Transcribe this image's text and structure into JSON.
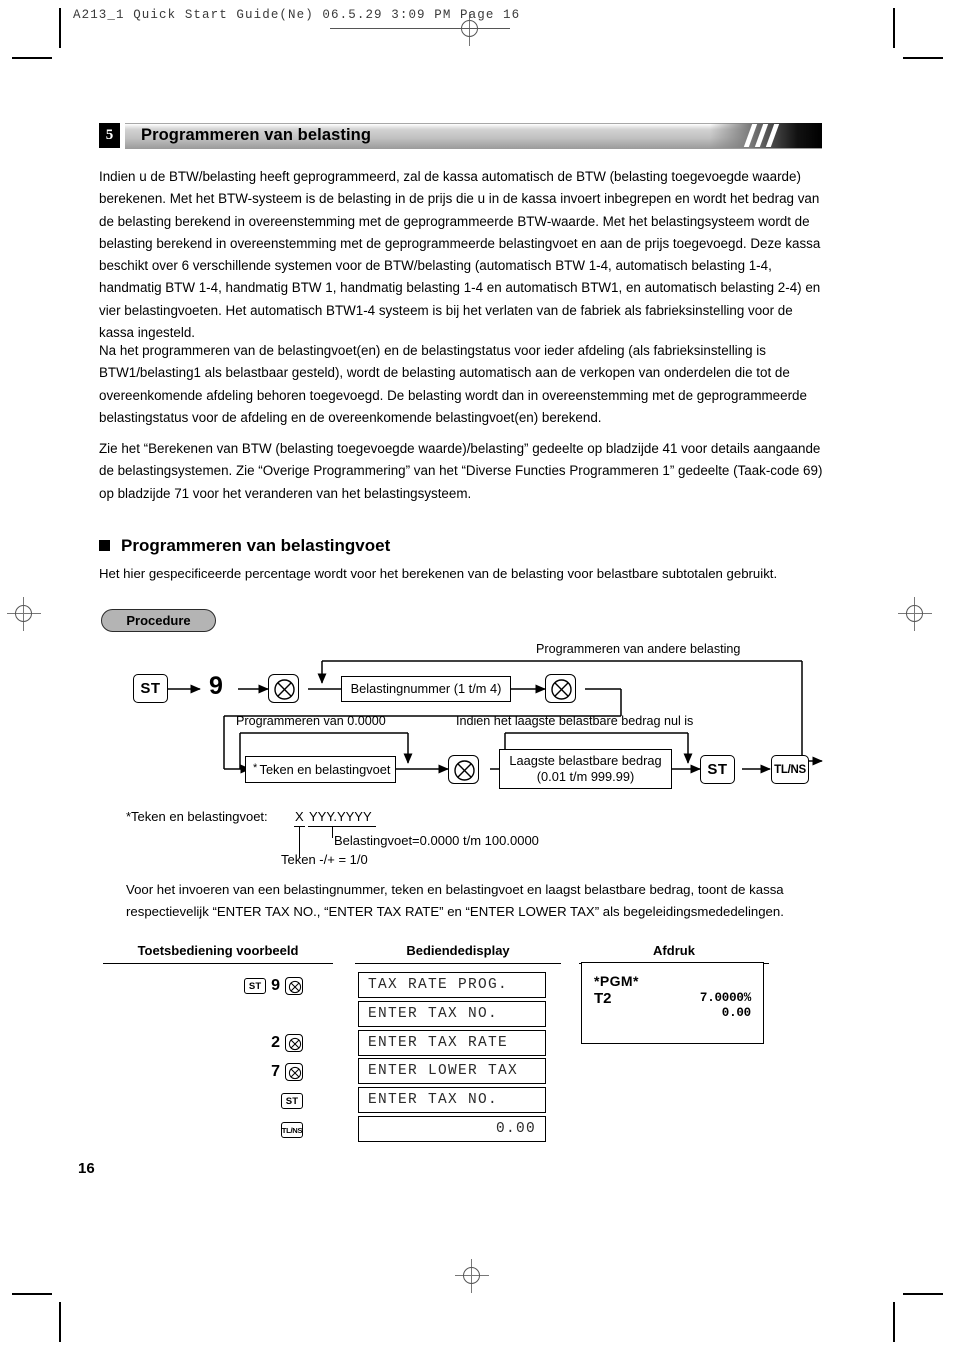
{
  "running_head": "A213_1 Quick Start Guide(Ne)  06.5.29 3:09 PM  Page 16",
  "section": {
    "number": "5",
    "title": "Programmeren van belasting"
  },
  "paragraphs": {
    "p1": "Indien u de BTW/belasting heeft geprogrammeerd, zal de kassa automatisch de BTW (belasting toegevoegde waarde) berekenen. Met het BTW-systeem is de belasting in de prijs die u in de kassa invoert inbegrepen en wordt het bedrag van de belasting berekend in overeenstemming met de geprogrammeerde BTW-waarde. Met het belastingsysteem wordt de belasting berekend in overeenstemming met de geprogrammeerde belastingvoet en aan de prijs toegevoegd. Deze kassa beschikt over 6 verschillende systemen voor de BTW/belasting (automatisch BTW 1-4, automatisch belasting 1-4, handmatig BTW 1-4, handmatig BTW 1, handmatig belasting 1-4 en automatisch BTW1, en automatisch belasting 2-4) en vier belastingvoeten. Het automatisch BTW1-4 systeem is bij het verlaten van de fabriek als fabrieksinstelling voor de kassa ingesteld.",
    "p2": "Na het programmeren van de belastingvoet(en) en de belastingstatus voor ieder afdeling (als fabrieksinstelling is BTW1/belasting1 als belastbaar gesteld), wordt de belasting automatisch aan de verkopen van onderdelen die tot de overeenkomende afdeling behoren toegevoegd. De belasting wordt dan in overeenstemming met de geprogrammeerde belastingstatus voor de afdeling en de overeenkomende belastingvoet(en) berekend.",
    "p3": "Zie het “Berekenen van BTW (belasting toegevoegde waarde)/belasting” gedeelte op bladzijde 41 voor details aangaande de belastingsystemen. Zie “Overige Programmering” van het “Diverse Functies Programmeren 1” gedeelte (Taak-code 69) op bladzijde 71 voor het veranderen van het belastingsysteem.",
    "p4": "Voor het invoeren van een belastingnummer, teken en belastingvoet en laagst belastbare bedrag, toont de kassa respectievelijk “ENTER TAX NO., “ENTER TAX RATE” en “ENTER LOWER TAX” als begeleidingsmededelingen."
  },
  "subsection": {
    "title": "Programmeren van belastingvoet",
    "intro": "Het hier gespecificeerde percentage wordt voor het berekenen van de belasting voor belastbare subtotalen gebruikt.",
    "procedure_label": "Procedure"
  },
  "flowchart": {
    "key_st": "ST",
    "key_digit": "9",
    "key_tlns": "TL/NS",
    "key_st2": "ST",
    "box_taxno": "Belastingnummer (1 t/m 4)",
    "box_rate": "Teken en belastingvoet",
    "box_rate_star": "*",
    "box_lower_line1": "Laagste belastbare bedrag",
    "box_lower_line2": "(0.01 t/m 999.99)",
    "label_other_tax": "Programmeren van andere belasting",
    "label_zero": "Programmeren van 0.0000",
    "label_lowest_null": "Indien het laagste belastbare bedrag nul is"
  },
  "footnote": {
    "prefix": "*Teken en belastingvoet:",
    "x": "X",
    "yyyy": "YYY.YYYY",
    "rate_note": "Belastingvoet=0.0000 t/m 100.0000",
    "sign_note": "Teken -/+ = 1/0"
  },
  "table": {
    "headers": {
      "keys": "Toetsbediening voorbeeld",
      "display": "Bediendedisplay",
      "print": "Afdruk"
    },
    "rows": [
      {
        "keys": [
          "ST",
          "9",
          "X"
        ],
        "display": "TAX RATE PROG.",
        "align": "left"
      },
      {
        "keys": [],
        "display": "ENTER TAX NO.",
        "align": "left"
      },
      {
        "keys": [
          "2",
          "X"
        ],
        "display": "ENTER TAX RATE",
        "align": "left"
      },
      {
        "keys": [
          "7",
          "X"
        ],
        "display": "ENTER LOWER TAX",
        "align": "left"
      },
      {
        "keys": [
          "ST"
        ],
        "display": "ENTER TAX NO.",
        "align": "left"
      },
      {
        "keys": [
          "TL/NS"
        ],
        "display": "0.00",
        "align": "right"
      }
    ]
  },
  "receipt": {
    "pgm": "*PGM*",
    "tax_label": "T2",
    "rate": "7.0000%",
    "amount": "0.00"
  },
  "page_number": "16"
}
